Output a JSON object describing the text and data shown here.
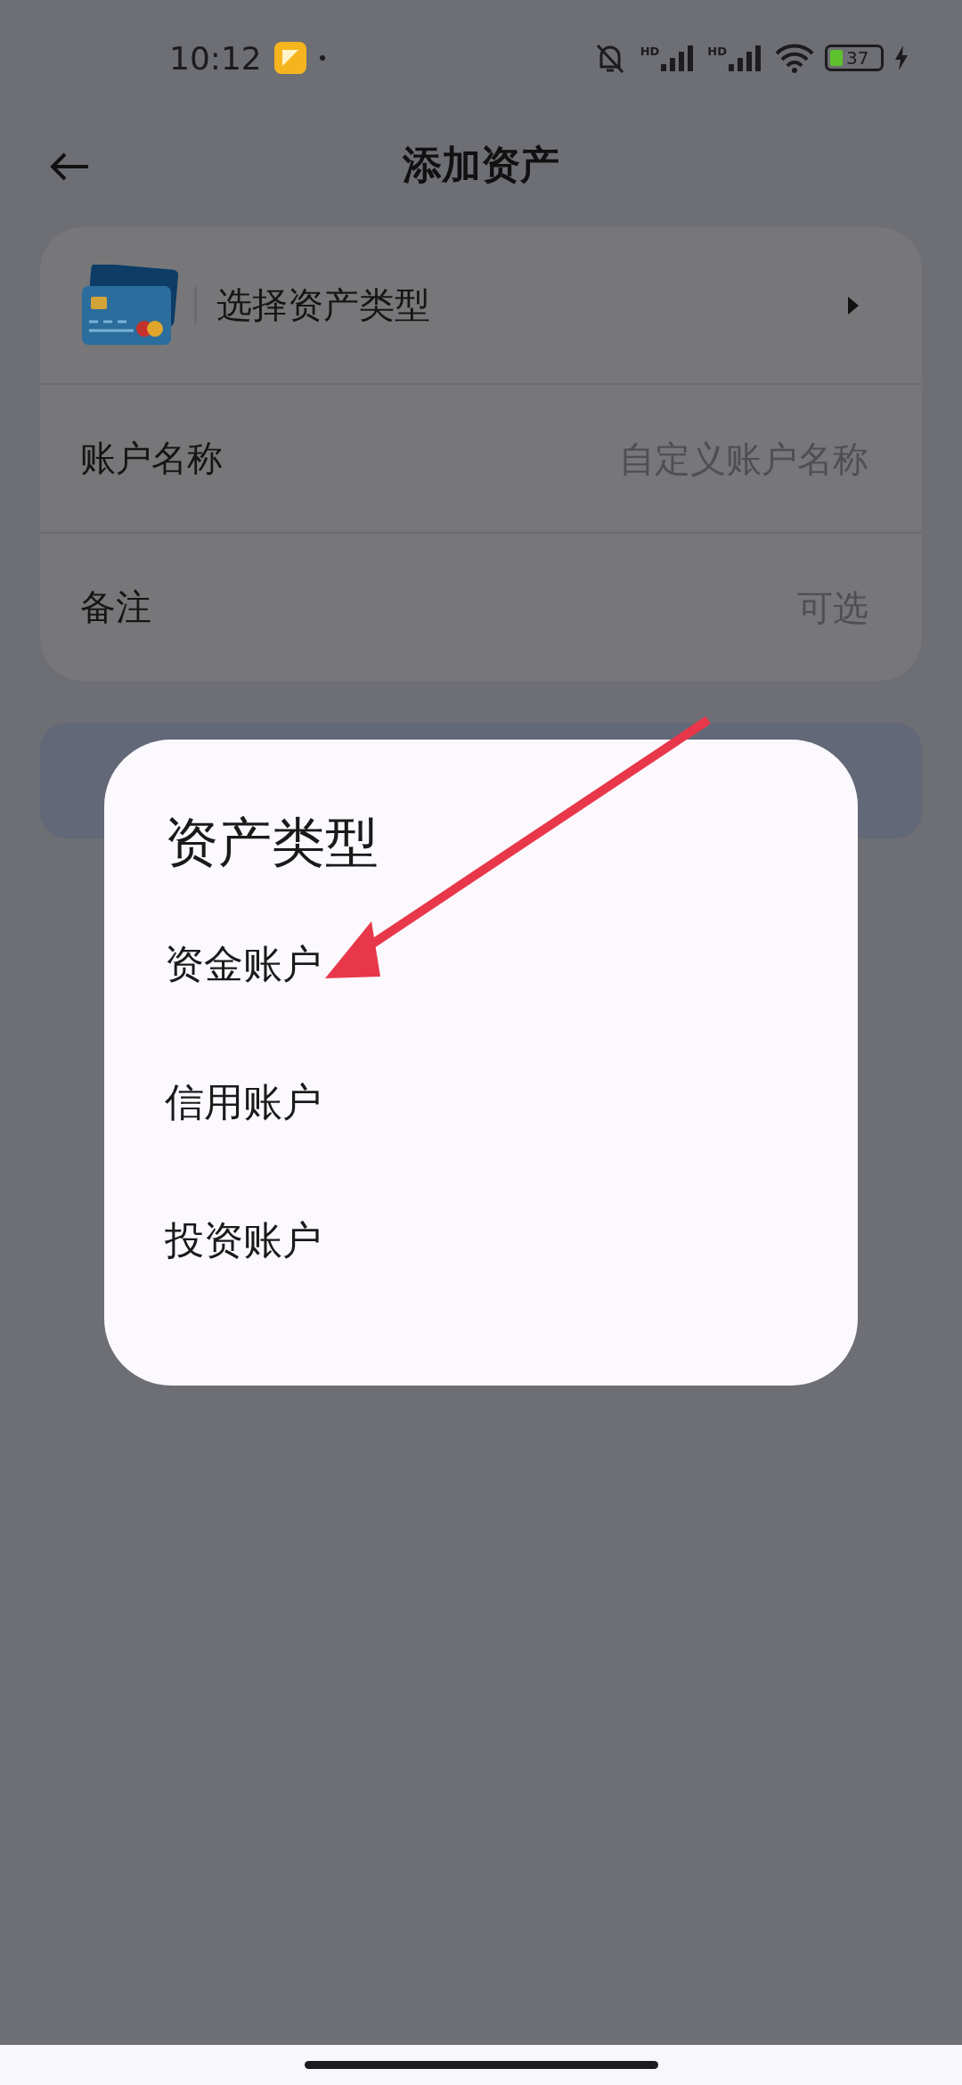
{
  "status_bar": {
    "time": "10:12",
    "signals": [
      {
        "label": "HD"
      },
      {
        "label": "HD"
      }
    ],
    "battery": "37"
  },
  "header": {
    "title": "添加资产"
  },
  "form": {
    "type_row": {
      "label": "选择资产类型"
    },
    "fields": [
      {
        "label": "账户名称",
        "placeholder": "自定义账户名称"
      },
      {
        "label": "备注",
        "placeholder": "可选"
      }
    ]
  },
  "dialog": {
    "title": "资产类型",
    "options": [
      {
        "label": "资金账户"
      },
      {
        "label": "信用账户"
      },
      {
        "label": "投资账户"
      }
    ]
  }
}
